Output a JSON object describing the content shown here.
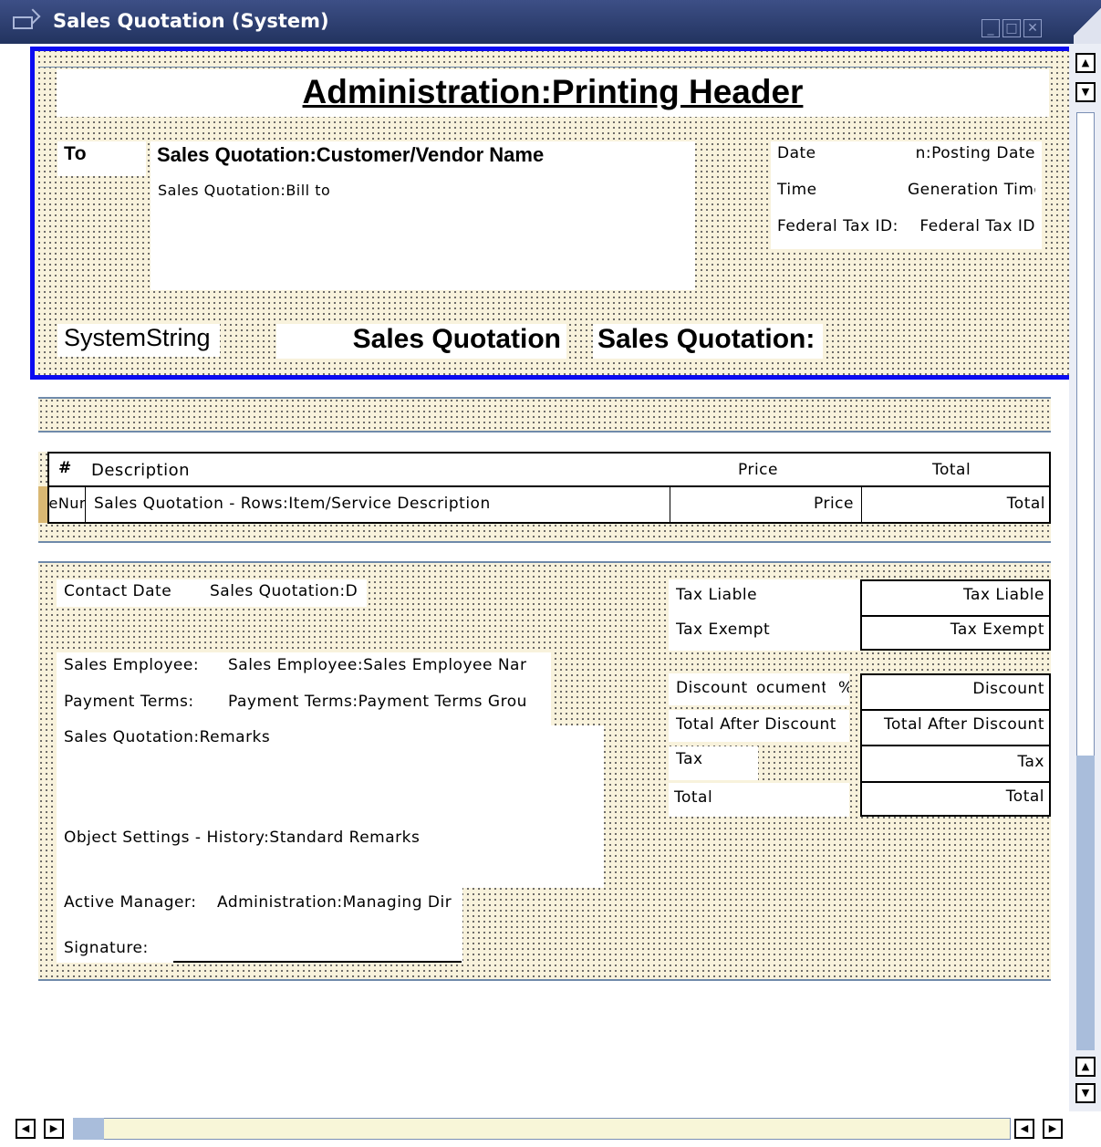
{
  "window": {
    "title": "Sales Quotation (System)",
    "icons": [
      "minimize-icon",
      "maximize-icon",
      "close-icon"
    ]
  },
  "header_section": {
    "printing_header": "Administration:Printing Header",
    "to_label": "To",
    "customer_name": "Sales Quotation:Customer/Vendor Name",
    "bill_to": "Sales Quotation:Bill to",
    "date_label": "Date",
    "date_value": "n:Posting Date",
    "time_label": "Time",
    "time_value": "Generation Time",
    "fedtax_label": "Federal Tax ID:",
    "fedtax_value": "Federal Tax ID",
    "system_string": "SystemString",
    "doc_title": "Sales Quotation",
    "doc_title2": "Sales Quotation:"
  },
  "table": {
    "headers": {
      "num": "#",
      "description": "Description",
      "price": "Price",
      "total": "Total"
    },
    "row": {
      "num": "eNur",
      "description": "Sales Quotation - Rows:Item/Service Description",
      "price": "Price",
      "total": "Total"
    }
  },
  "footer_section": {
    "contact_date_label": "Contact Date",
    "contact_date_value": "Sales Quotation:D",
    "sales_employee_label": "Sales Employee:",
    "sales_employee_value": "Sales Employee:Sales Employee Nar",
    "payment_terms_label": "Payment Terms:",
    "payment_terms_value": "Payment Terms:Payment Terms Grou",
    "remarks": "Sales Quotation:Remarks",
    "standard_remarks": "Object Settings - History:Standard Remarks",
    "active_manager_label": "Active Manager:",
    "active_manager_value": "Administration:Managing Dir",
    "signature_label": "Signature:"
  },
  "totals": {
    "tax_liable_label": "Tax Liable",
    "tax_liable_value": "Tax Liable",
    "tax_exempt_label": "Tax Exempt",
    "tax_exempt_value": "Tax Exempt",
    "discount_label": "Discount",
    "discount_doc": "ocument",
    "discount_pct": "%",
    "discount_value": "Discount",
    "total_after_label": "Total After Discount",
    "total_after_value": "Total After Discount",
    "tax_label": "Tax",
    "tax_value": "Tax",
    "total_label": "Total",
    "total_value": "Total"
  },
  "scrollbars": {
    "up": "▲",
    "down": "▼",
    "left": "◀",
    "right": "▶"
  }
}
